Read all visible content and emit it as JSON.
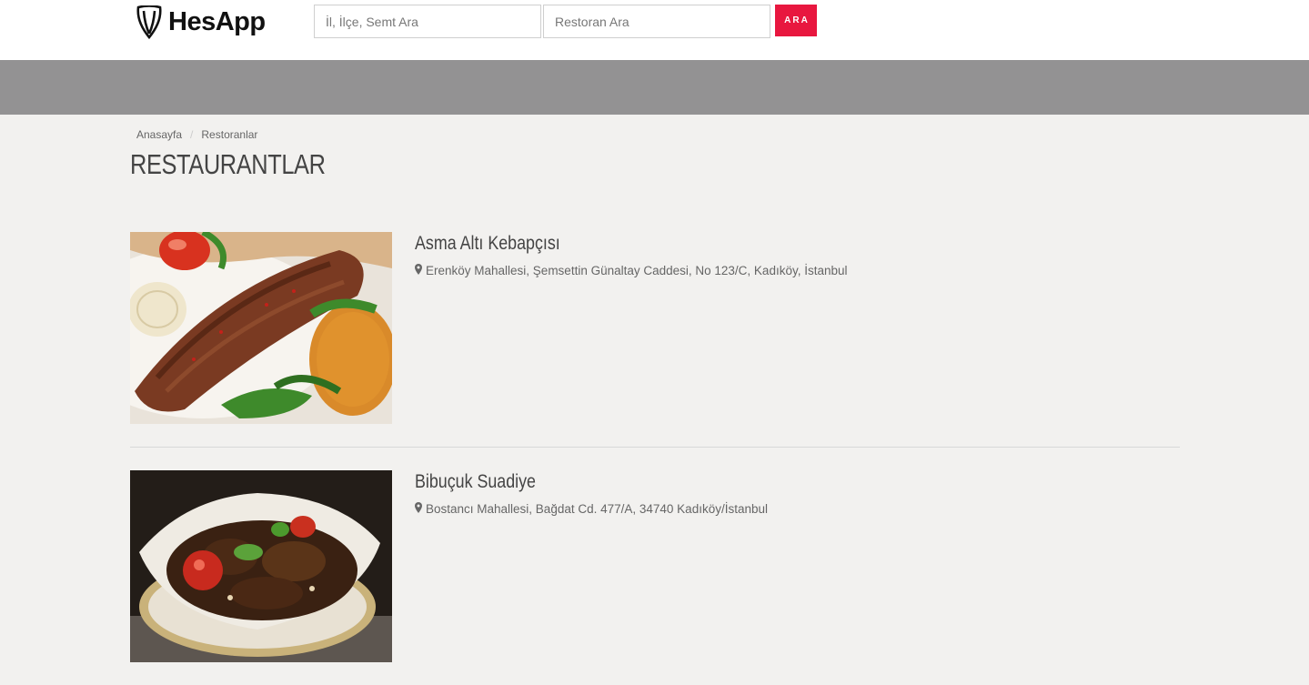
{
  "header": {
    "logo_text": "HesApp",
    "logo_icon": "shield-logo-icon",
    "location_search": {
      "placeholder": "İl, İlçe, Semt Ara",
      "value": ""
    },
    "restaurant_search": {
      "placeholder": "Restoran Ara",
      "value": ""
    },
    "search_button_label": "ARA",
    "accent_color": "#e8173f"
  },
  "breadcrumb": {
    "items": [
      "Anasayfa",
      "Restoranlar"
    ],
    "separator": "/"
  },
  "page_title": "RESTAURANTLAR",
  "restaurants": [
    {
      "name": "Asma Altı Kebapçısı",
      "address": "Erenköy Mahallesi, Şemsettin Günaltay Caddesi, No 123/C, Kadıköy, İstanbul",
      "image": "kebab-plate-photo"
    },
    {
      "name": "Bibuçuk Suadiye",
      "address": "Bostancı Mahallesi, Bağdat Cd. 477/A, 34740 Kadıköy/İstanbul",
      "image": "kebab-basket-photo"
    }
  ]
}
